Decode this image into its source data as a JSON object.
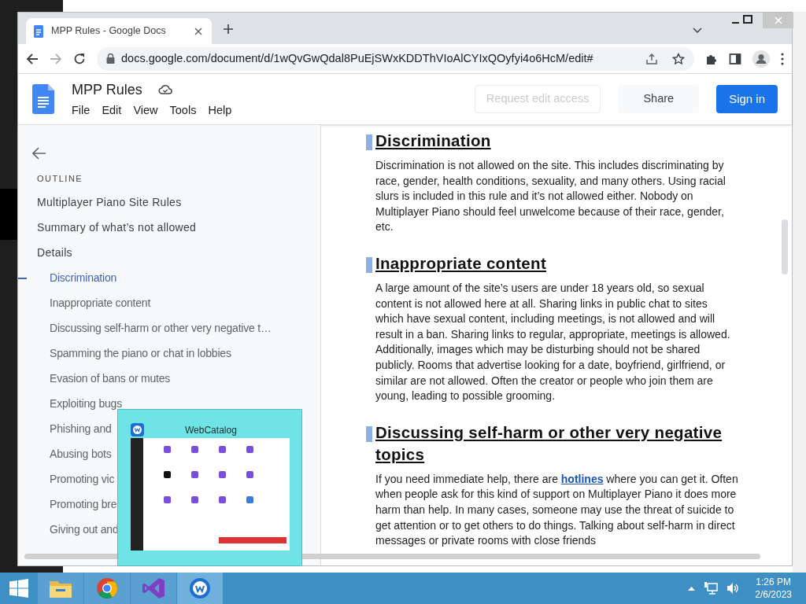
{
  "browser": {
    "tabs": [
      {
        "title": "MPP Rules - Google Docs",
        "selected": true
      }
    ],
    "address": "docs.google.com/document/d/1wQvGwQdal8PuEjSWxKDDThVIoAlCYIxQOyfyi4o6HcM/edit#"
  },
  "docs_header": {
    "title": "MPP Rules",
    "menus": [
      "File",
      "Edit",
      "View",
      "Tools",
      "Help"
    ],
    "buttons": [
      {
        "kind": "outline",
        "label": "Request edit access",
        "disabled": true
      },
      {
        "kind": "plain",
        "label": "Share",
        "disabled": false
      },
      {
        "kind": "primary",
        "label": "Sign in",
        "disabled": false
      }
    ]
  },
  "outline": {
    "label": "OUTLINE",
    "items": [
      {
        "text": "Multiplayer Piano Site Rules",
        "selected": false
      },
      {
        "text": "Summary of what’s not allowed",
        "selected": false
      },
      {
        "text": "Details",
        "selected": false,
        "children": [
          {
            "text": "Discrimination",
            "selected": true
          },
          {
            "text": "Inappropriate content",
            "selected": false
          },
          {
            "text": "Discussing self-harm or other very negative t…",
            "selected": false
          },
          {
            "text": "Spamming the piano or chat in lobbies",
            "selected": false
          },
          {
            "text": "Evasion of bans or mutes",
            "selected": false
          },
          {
            "text": "Exploiting bugs",
            "selected": false
          },
          {
            "text": "Phishing and",
            "selected": false
          },
          {
            "text": "Abusing bots",
            "selected": false
          },
          {
            "text": "Promoting vic",
            "selected": false
          },
          {
            "text": "Promoting bre",
            "selected": false
          },
          {
            "text": "Giving out and",
            "selected": false
          }
        ]
      }
    ]
  },
  "document": {
    "sections": [
      {
        "heading": "Discrimination",
        "paragraph": [
          {
            "kind": "text",
            "text": "Discrimination is not allowed on the site. This includes discriminating by race, gender, health conditions, sexuality, and many others. Using racial slurs is included in this rule and it’s not  allowed either. Nobody on Multiplayer Piano should feel unwelcome because of their race, gender, etc."
          }
        ]
      },
      {
        "heading": "Inappropriate content",
        "paragraph": [
          {
            "kind": "text",
            "text": "A large amount of the site’s users are under 18 years old, so sexual content is not allowed here at all. Sharing links in public chat to sites which have sexual content, including meetings, is not allowed and will result in a ban. Sharing links to regular, appropriate, meetings is allowed. Additionally, images which may be disturbing should not be shared publicly. Rooms that advertise looking for a date, boyfriend, girlfriend, or similar are not allowed. Often the creator or people who join them are young, leading to possible grooming."
          }
        ]
      },
      {
        "heading": "Discussing self-harm or other very negative topics",
        "paragraph": [
          {
            "kind": "text",
            "text": "If you need immediate help, there are "
          },
          {
            "kind": "link",
            "text": "hotlines"
          },
          {
            "kind": "text",
            "text": " where you can get it. Often when people ask for this kind of support on Multiplayer Piano it does more harm than help. In many cases, someone may use the threat of suicide to get attention or to get others to do things. Talking about self-harm in direct messages or private rooms with close friends"
          }
        ]
      }
    ]
  },
  "preview": {
    "title": "WebCatalog"
  },
  "taskbar": {
    "apps": [
      {
        "kind": "explorer",
        "active": false
      },
      {
        "kind": "chrome",
        "active": false
      },
      {
        "kind": "studio",
        "active": false
      },
      {
        "kind": "webcatalog",
        "active": true
      }
    ],
    "time": "1:26 PM",
    "date": "2/6/2023"
  }
}
